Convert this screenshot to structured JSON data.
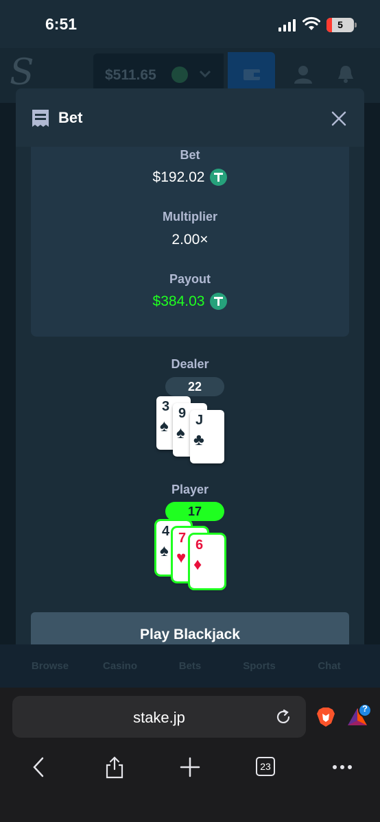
{
  "status_bar": {
    "time": "6:51",
    "battery": "5"
  },
  "site_header": {
    "balance": "$511.65"
  },
  "bottom_nav": [
    "Browse",
    "Casino",
    "Bets",
    "Sports",
    "Chat"
  ],
  "modal": {
    "title": "Bet",
    "bet_label": "Bet",
    "bet_value": "$192.02",
    "multiplier_label": "Multiplier",
    "multiplier_value": "2.00×",
    "payout_label": "Payout",
    "payout_value": "$384.03",
    "dealer": {
      "label": "Dealer",
      "score": "22",
      "cards": [
        {
          "rank": "3",
          "suit": "♠"
        },
        {
          "rank": "9",
          "suit": "♠"
        },
        {
          "rank": "J",
          "suit": "♣"
        }
      ]
    },
    "player": {
      "label": "Player",
      "score": "17",
      "cards": [
        {
          "rank": "4",
          "suit": "♠"
        },
        {
          "rank": "7",
          "suit": "♥"
        },
        {
          "rank": "6",
          "suit": "♦"
        }
      ]
    },
    "play_button": "Play Blackjack"
  },
  "browser": {
    "url": "stake.jp",
    "tab_count": "23",
    "badge": "?"
  },
  "colors": {
    "win_green": "#1fff20",
    "tether": "#26a17b",
    "background": "#1b2d39"
  }
}
